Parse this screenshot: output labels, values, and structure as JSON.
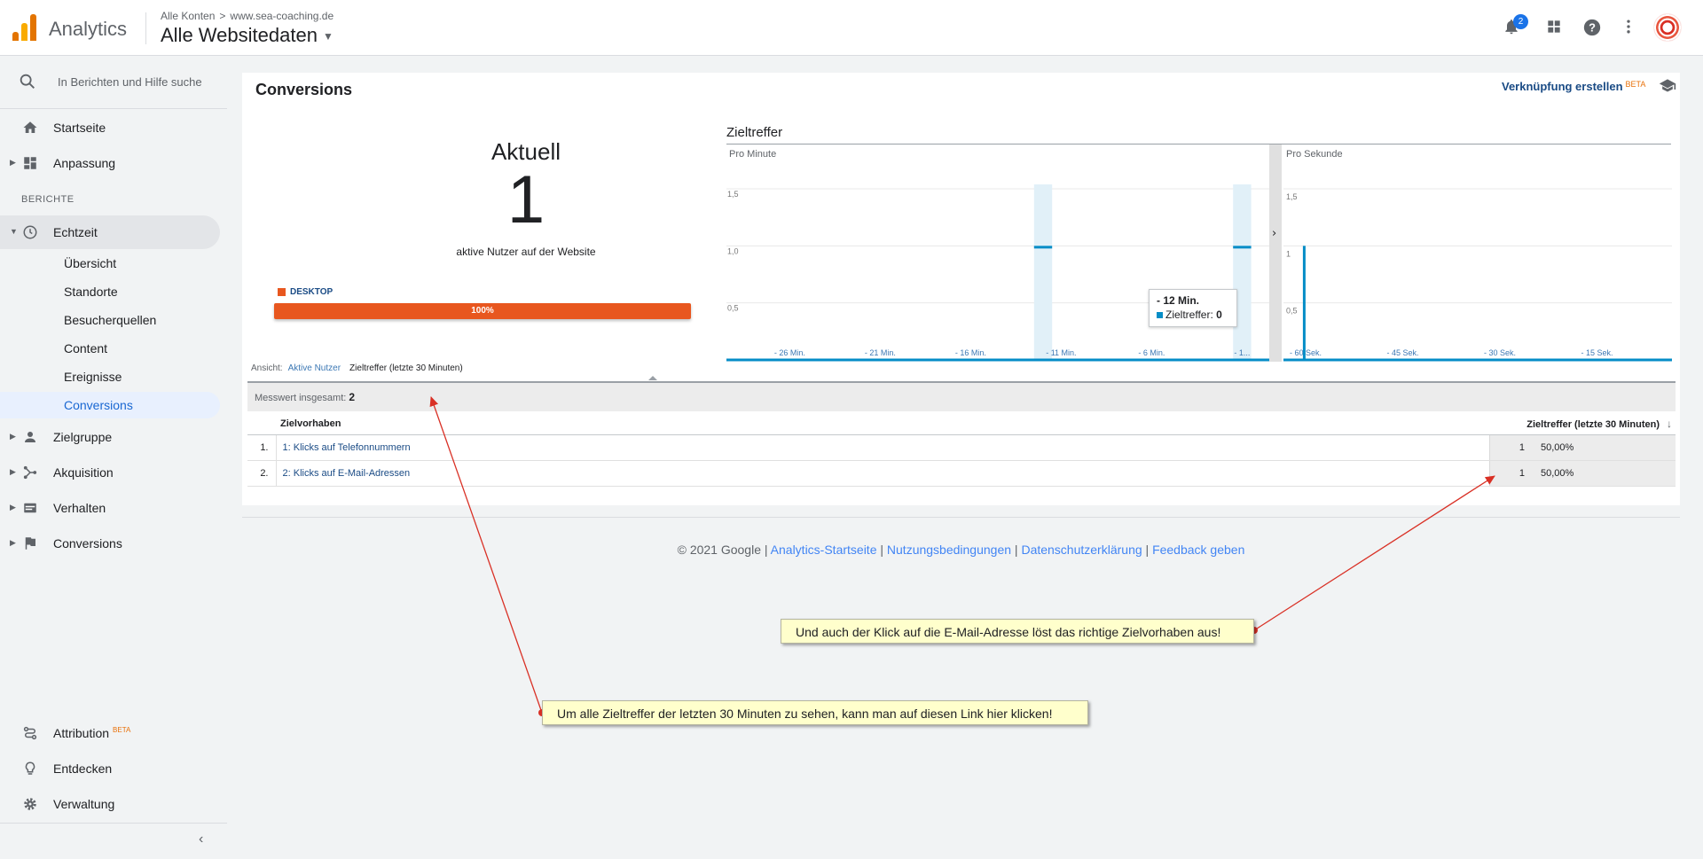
{
  "header": {
    "app_name": "Analytics",
    "breadcrumb": [
      "Alle Konten",
      "www.sea-coaching.de"
    ],
    "breadcrumb_sep": ">",
    "property_name": "Alle Websitedaten",
    "notification_count": "2",
    "icons": [
      "bell-icon",
      "apps-icon",
      "help-icon",
      "more-icon",
      "avatar"
    ],
    "accent_color": "#1a73e8"
  },
  "sidebar": {
    "search_placeholder": "In Berichten und Hilfe suche",
    "items_top": [
      {
        "label": "Startseite",
        "icon": "home-icon"
      },
      {
        "label": "Anpassung",
        "icon": "dashboard-icon"
      }
    ],
    "section_label": "BERICHTE",
    "realtime": {
      "label": "Echtzeit",
      "icon": "clock-icon"
    },
    "realtime_children": [
      "Übersicht",
      "Standorte",
      "Besucherquellen",
      "Content",
      "Ereignisse",
      "Conversions"
    ],
    "items_reports": [
      {
        "label": "Zielgruppe",
        "icon": "person-icon"
      },
      {
        "label": "Akquisition",
        "icon": "acquisition-icon"
      },
      {
        "label": "Verhalten",
        "icon": "behavior-icon"
      },
      {
        "label": "Conversions",
        "icon": "flag-icon"
      }
    ],
    "items_bottom": [
      {
        "label": "Attribution",
        "badge": "BETA",
        "icon": "attribution-icon"
      },
      {
        "label": "Entdecken",
        "icon": "lightbulb-icon"
      },
      {
        "label": "Verwaltung",
        "icon": "gear-icon"
      }
    ]
  },
  "main": {
    "title": "Conversions",
    "link_create": "Verknüpfung erstellen",
    "link_badge": "BETA",
    "current": {
      "label": "Aktuell",
      "value": "1",
      "subtitle": "aktive Nutzer auf der Website",
      "device_label": "DESKTOP",
      "device_percent": "100%",
      "device_fraction": 1.0,
      "device_color": "#e8571f"
    },
    "view": {
      "label": "Ansicht:",
      "option_1": "Aktive Nutzer",
      "option_2": "Zieltreffer (letzte 30 Minuten)"
    },
    "summary_label": "Messwert insgesamt:",
    "summary_value": "2",
    "table": {
      "col_goal": "Zielvorhaben",
      "col_metric": "Zieltreffer (letzte 30 Minuten)",
      "rows": [
        {
          "index": "1.",
          "goal": "1: Klicks auf Telefonnummern",
          "value": "1",
          "percent": "50,00%"
        },
        {
          "index": "2.",
          "goal": "2: Klicks auf E-Mail-Adressen",
          "value": "1",
          "percent": "50,00%"
        }
      ]
    },
    "tooltip": {
      "title": "- 12 Min.",
      "series": "Zieltreffer",
      "value": "0"
    }
  },
  "chart_data": {
    "type": "bar",
    "title": "Zieltreffer",
    "panels": [
      {
        "name": "Pro Minute",
        "x_ticks": [
          "- 26 Min.",
          "- 21 Min.",
          "- 16 Min.",
          "- 11 Min.",
          "- 6 Min.",
          "- 1..."
        ],
        "y_ticks": [
          "0,5",
          "1,0",
          "1,5"
        ],
        "ylim": [
          0,
          1.5
        ],
        "bars": [
          {
            "x": "- 12 Min.",
            "y": 1
          },
          {
            "x": "- 1 Min.",
            "y": 1
          }
        ],
        "highlighted": [
          "- 12 Min.",
          "- 1 Min."
        ]
      },
      {
        "name": "Pro Sekunde",
        "x_ticks": [
          "- 60 Sek.",
          "- 45 Sek.",
          "- 30 Sek.",
          "- 15 Sek."
        ],
        "y_ticks": [
          "0,5",
          "1",
          "1,5"
        ],
        "ylim": [
          0,
          1.5
        ],
        "bars": [
          {
            "x": "- 57 Sek.",
            "y": 1
          }
        ]
      }
    ],
    "series_color": "#058dc7"
  },
  "footer": {
    "copyright": "© 2021 Google",
    "links": [
      "Analytics-Startseite",
      "Nutzungsbedingungen",
      "Datenschutzerklärung",
      "Feedback geben"
    ],
    "sep": "|"
  },
  "annotations": {
    "note_email": "Und auch der Klick auf die E-Mail-Adresse löst das richtige Zielvorhaben aus!",
    "note_link": "Um alle Zieltreffer der letzten 30 Minuten zu sehen, kann man auf diesen Link hier klicken!",
    "arrow_color": "#d93025"
  }
}
